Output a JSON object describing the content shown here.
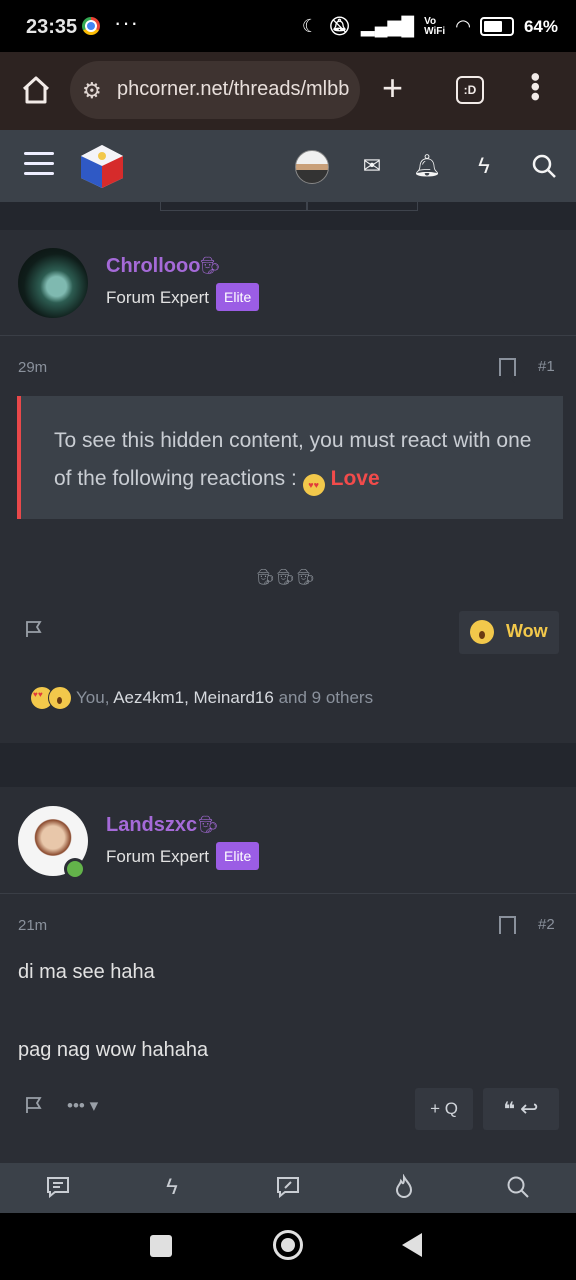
{
  "status_bar": {
    "time": "23:35",
    "dots": "···",
    "network": "Vo WiFi",
    "battery": "64%"
  },
  "browser": {
    "url": "phcorner.net/threads/mlbb",
    "tabs_label": ":D"
  },
  "posts": [
    {
      "username": "Chrollooo",
      "user_title": "Forum Expert",
      "badge": "Elite",
      "time": "29m",
      "post_number": "#1",
      "hidden_text": "To see this hidden content, you must react with one of the following reactions : ",
      "hidden_reaction": "Love",
      "reaction_button": "Wow",
      "reactions_you": "You, ",
      "reactions_users": "Aez4km1, Meinard16",
      "reactions_others": " and 9 others"
    },
    {
      "username": "Landszxc",
      "user_title": "Forum Expert",
      "badge": "Elite",
      "time": "21m",
      "post_number": "#2",
      "body_line1": "di ma see haha",
      "body_line2": "pag nag wow hahaha",
      "quote_button": "+ Q"
    }
  ],
  "colors": {
    "username": "#a56ad8",
    "badge": "#9b5de5",
    "hidden_border": "#e8484a",
    "wow": "#f2c84b"
  }
}
